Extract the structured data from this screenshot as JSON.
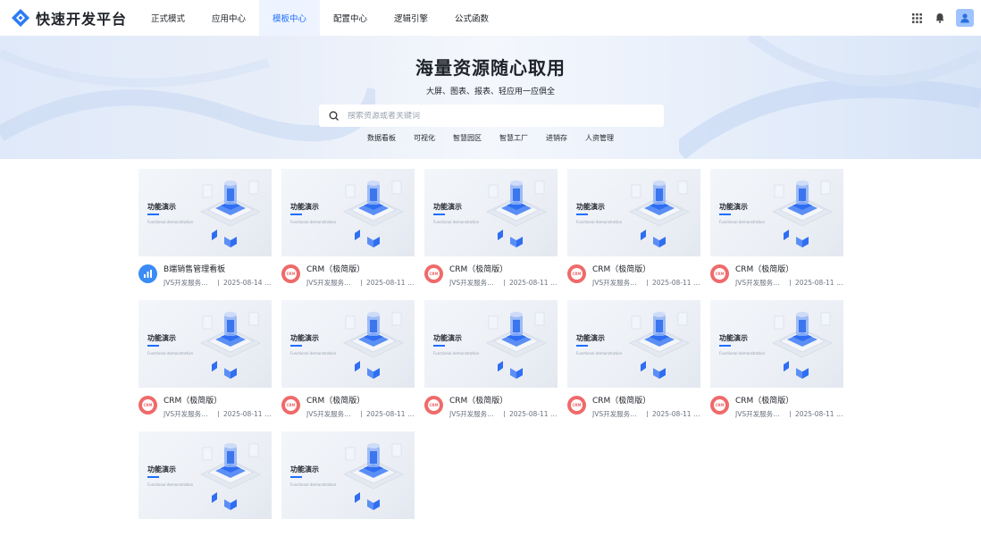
{
  "brand": {
    "name": "快速开发平台"
  },
  "nav": {
    "items": [
      {
        "label": "正式模式",
        "active": false
      },
      {
        "label": "应用中心",
        "active": false
      },
      {
        "label": "模板中心",
        "active": true
      },
      {
        "label": "配置中心",
        "active": false
      },
      {
        "label": "逻辑引擎",
        "active": false
      },
      {
        "label": "公式函数",
        "active": false
      }
    ]
  },
  "tools": {
    "apps_icon": "grid-icon",
    "bell_icon": "bell-icon",
    "avatar_icon": "user-icon"
  },
  "hero": {
    "title": "海量资源随心取用",
    "subtitle": "大屏、图表、报表、轻应用一应俱全",
    "search_placeholder": "搜索资源或者关键词",
    "tags": [
      "数据看板",
      "可视化",
      "智慧园区",
      "智慧工厂",
      "进销存",
      "人资管理"
    ]
  },
  "thumbnail": {
    "label": "功能演示",
    "small": "Functional demonstration"
  },
  "cards": [
    {
      "title": "B端销售管理看板",
      "author": "JVS开发服务…",
      "date": "2025-08-14 1…",
      "icon": "bi"
    },
    {
      "title": "CRM（极简版）",
      "author": "JVS开发服务…",
      "date": "2025-08-11 1…",
      "icon": "crm"
    },
    {
      "title": "CRM（极简版）",
      "author": "JVS开发服务…",
      "date": "2025-08-11 1…",
      "icon": "crm"
    },
    {
      "title": "CRM（极简版）",
      "author": "JVS开发服务…",
      "date": "2025-08-11 1…",
      "icon": "crm"
    },
    {
      "title": "CRM（极简版）",
      "author": "JVS开发服务…",
      "date": "2025-08-11 1…",
      "icon": "crm"
    },
    {
      "title": "CRM（极简版）",
      "author": "JVS开发服务…",
      "date": "2025-08-11 1…",
      "icon": "crm"
    },
    {
      "title": "CRM（极简版）",
      "author": "JVS开发服务…",
      "date": "2025-08-11 1…",
      "icon": "crm"
    },
    {
      "title": "CRM（极简版）",
      "author": "JVS开发服务…",
      "date": "2025-08-11 1…",
      "icon": "crm"
    },
    {
      "title": "CRM（极简版）",
      "author": "JVS开发服务…",
      "date": "2025-08-11 1…",
      "icon": "crm"
    },
    {
      "title": "CRM（极简版）",
      "author": "JVS开发服务…",
      "date": "2025-08-11 1…",
      "icon": "crm"
    },
    {
      "title": "",
      "author": "",
      "date": "",
      "icon": "none"
    },
    {
      "title": "",
      "author": "",
      "date": "",
      "icon": "none"
    }
  ],
  "colors": {
    "accent": "#1e6fff",
    "crm": "#ef6a6a",
    "bi": "#3a8bf5"
  }
}
